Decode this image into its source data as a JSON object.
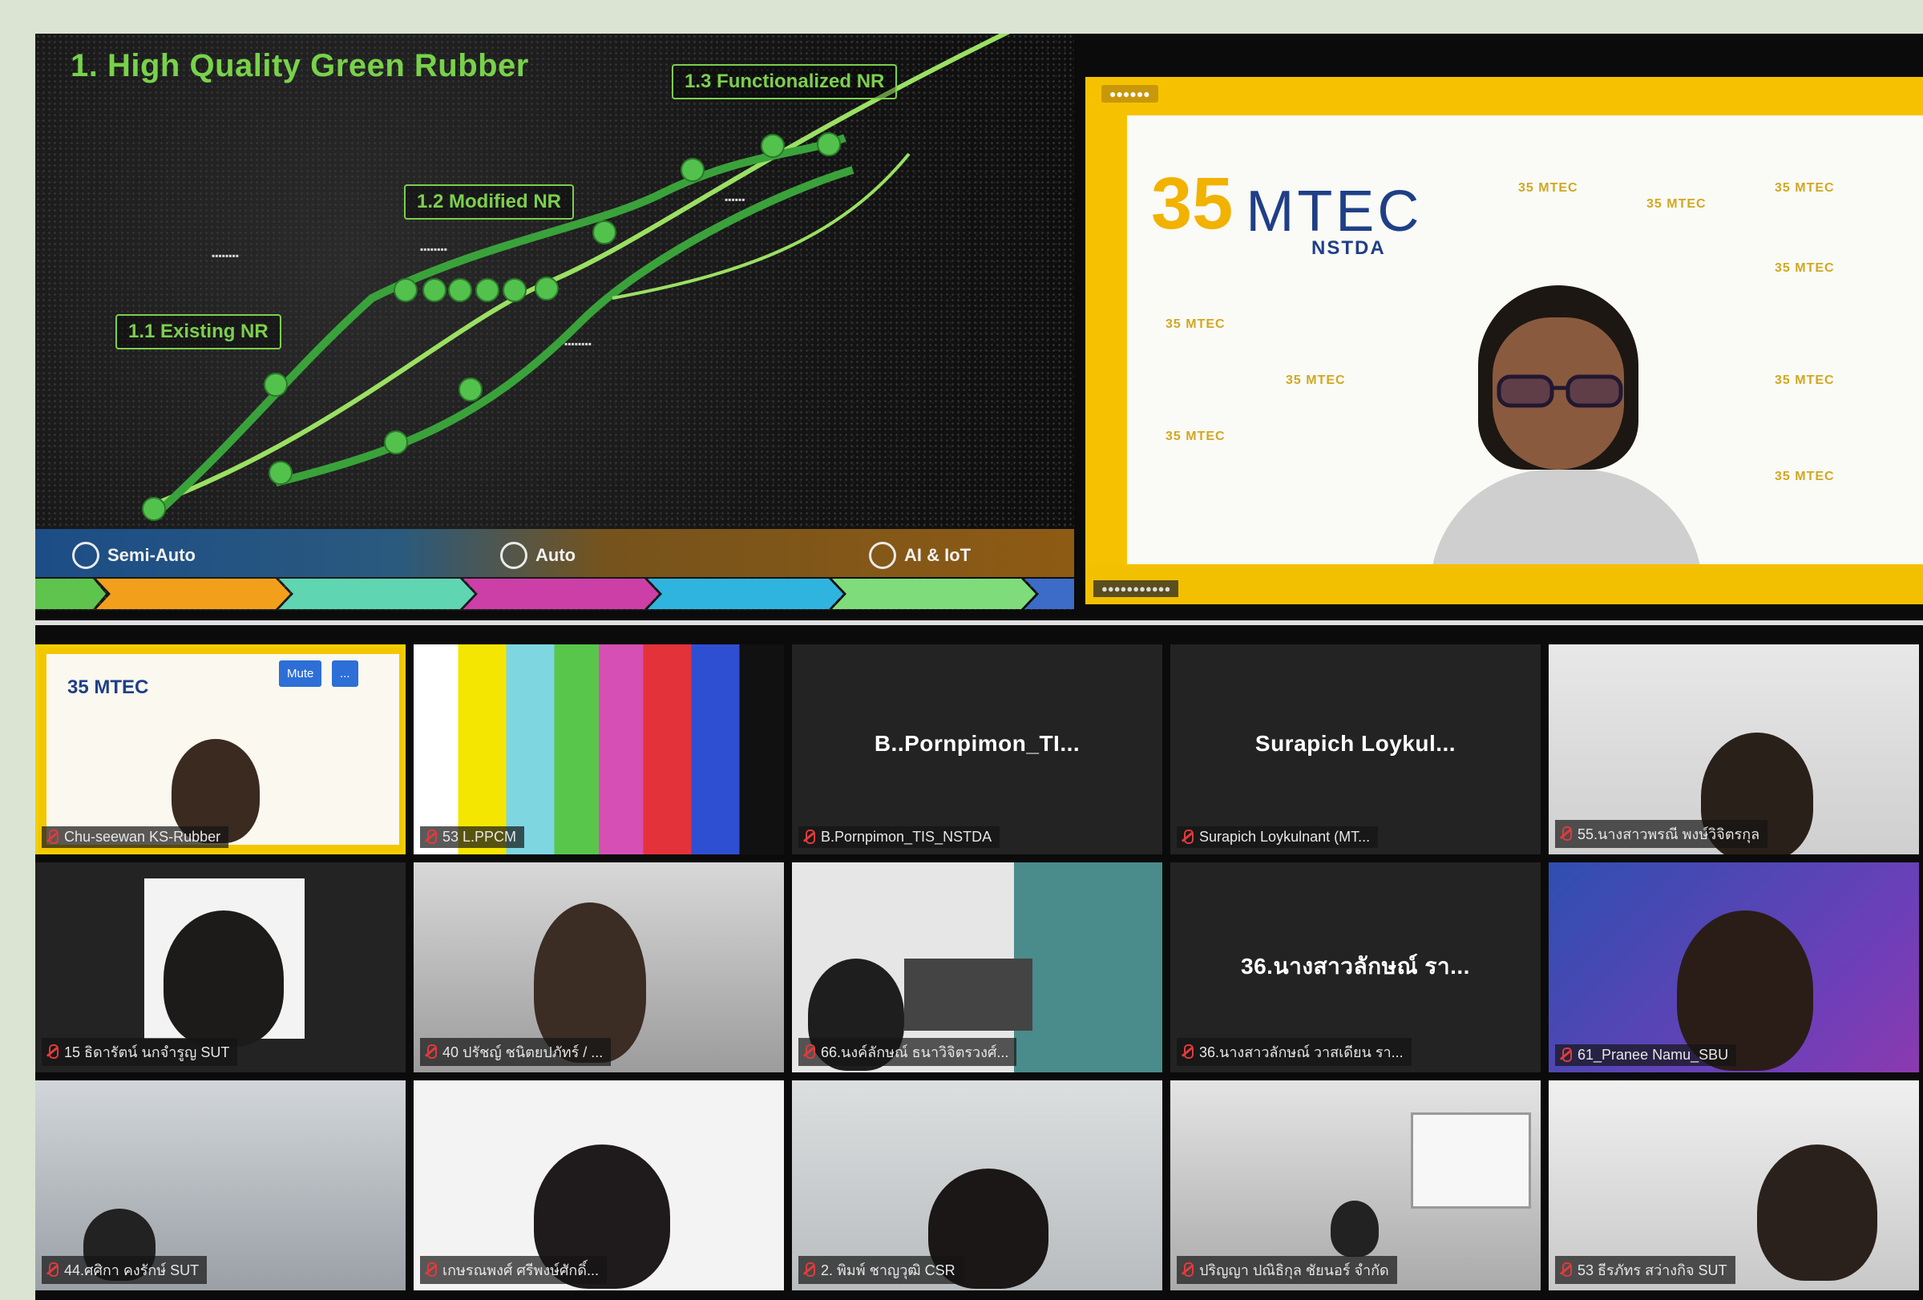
{
  "slide": {
    "title": "1. High Quality Green Rubber",
    "stages": [
      "1.1 Existing NR",
      "1.2 Modified NR",
      "1.3 Functionalized NR"
    ],
    "bands": [
      "Semi-Auto",
      "Auto",
      "AI & IoT"
    ]
  },
  "speaker": {
    "logo_number": "35",
    "logo_name": "MTEC",
    "logo_org": "NSTDA",
    "mini_logo": "35 MTEC"
  },
  "grid": {
    "tiles": [
      {
        "id": "t1",
        "center": "",
        "caption": "Chu-seewan KS-Rubber"
      },
      {
        "id": "t2",
        "center": "",
        "caption": "53 L.PPCM"
      },
      {
        "id": "t3",
        "center": "B..Pornpimon_TI...",
        "caption": "B.Pornpimon_TIS_NSTDA"
      },
      {
        "id": "t4",
        "center": "Surapich  Loykul...",
        "caption": "Surapich Loykulnant (MT..."
      },
      {
        "id": "t5",
        "center": "",
        "caption": "55.นางสาวพรณี พงษ์วิจิตรกุล"
      },
      {
        "id": "t6",
        "center": "",
        "caption": "15 ธิดารัตน์ นกจำรูญ SUT"
      },
      {
        "id": "t7",
        "center": "",
        "caption": "40 ปรัชญ์ ชนิตยปภัทร์ / ..."
      },
      {
        "id": "t8",
        "center": "",
        "caption": "66.นงค์ลักษณ์ ธนาวิจิตรวงศ์..."
      },
      {
        "id": "t9",
        "center": "36.นางสาวลักษณ์ รา...",
        "caption": "36.นางสาวลักษณ์ วาสเดียน รา..."
      },
      {
        "id": "t10",
        "center": "",
        "caption": "61_Pranee Namu_SBU"
      },
      {
        "id": "t11",
        "center": "",
        "caption": "44.ศศิกา คงรักษ์ SUT"
      },
      {
        "id": "t12",
        "center": "",
        "caption": "เกษรณพงศ์ ศรีพงษ์ศักดิ์..."
      },
      {
        "id": "t13",
        "center": "",
        "caption": "2. พิมพ์ ชาญวุฒิ CSR"
      },
      {
        "id": "t14",
        "center": "",
        "caption": "ปริญญา ปณิธิกุล ชัยนอร์ จำกัด"
      },
      {
        "id": "t15",
        "center": "",
        "caption": "53 ธีรภัทร สว่างกิจ SUT"
      }
    ],
    "mute_buttons": [
      "Mute",
      "..."
    ]
  },
  "colors": {
    "slide_green": "#78d24a",
    "speaker_yellow": "#f6c200",
    "mic_muted_red": "#e03b3b",
    "active_border": "#f1d000"
  }
}
